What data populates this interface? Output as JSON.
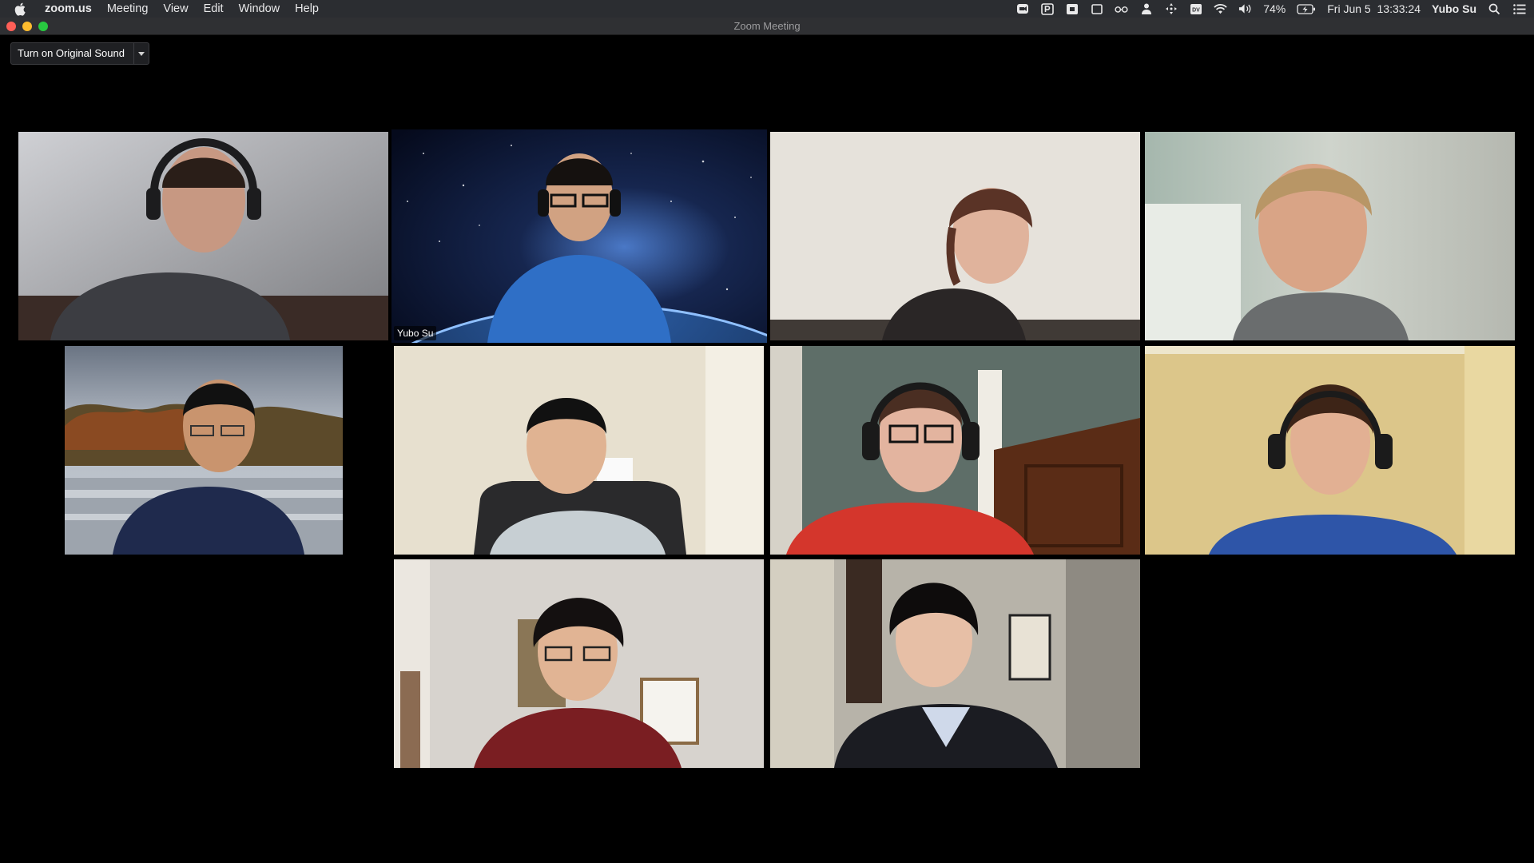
{
  "menubar": {
    "app_name": "zoom.us",
    "menus": [
      "Meeting",
      "View",
      "Edit",
      "Window",
      "Help"
    ],
    "battery": "74%",
    "datetime": "Fri Jun 5  13:33:24",
    "user": "Yubo Su"
  },
  "window": {
    "title": "Zoom Meeting"
  },
  "toolbar": {
    "original_sound_label": "Turn on Original Sound"
  },
  "participants": [
    {
      "name": "",
      "active": false
    },
    {
      "name": "Yubo Su",
      "active": true
    },
    {
      "name": "",
      "active": false
    },
    {
      "name": "",
      "active": false
    },
    {
      "name": "",
      "active": false
    },
    {
      "name": "",
      "active": false
    },
    {
      "name": "",
      "active": false
    },
    {
      "name": "",
      "active": false
    },
    {
      "name": "",
      "active": false
    },
    {
      "name": "",
      "active": false
    }
  ],
  "colors": {
    "active_speaker_border": "#d8de7a",
    "menubar_bg": "#2b2d31",
    "window_bg": "#000000"
  }
}
